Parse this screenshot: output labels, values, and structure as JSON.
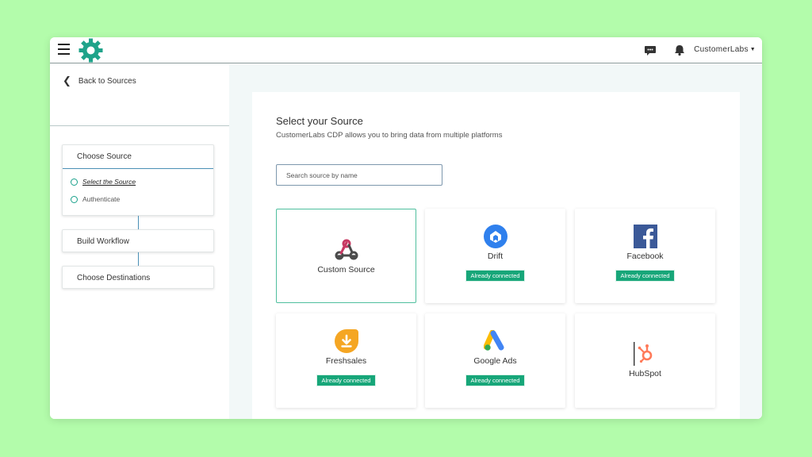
{
  "topbar": {
    "user_label": "CustomerLabs"
  },
  "sidebar": {
    "back_label": "Back to Sources",
    "steps": [
      {
        "title": "Choose Source",
        "substeps": [
          "Select the Source",
          "Authenticate"
        ]
      },
      {
        "title": "Build Workflow"
      },
      {
        "title": "Choose Destinations"
      }
    ]
  },
  "main": {
    "title": "Select your Source",
    "subtitle": "CustomerLabs CDP allows you to bring data from multiple platforms",
    "search_placeholder": "Search source by name",
    "sources": [
      {
        "name": "Custom Source",
        "icon": "webhook-icon",
        "status": ""
      },
      {
        "name": "Drift",
        "icon": "drift-icon",
        "status": "Already connected"
      },
      {
        "name": "Facebook",
        "icon": "facebook-icon",
        "status": "Already connected"
      },
      {
        "name": "Freshsales",
        "icon": "freshsales-icon",
        "status": "Already connected"
      },
      {
        "name": "Google Ads",
        "icon": "google-ads-icon",
        "status": "Already connected"
      },
      {
        "name": "HubSpot",
        "icon": "hubspot-icon",
        "status": ""
      }
    ]
  },
  "colors": {
    "background": "#b3fcab",
    "accent": "#17a679",
    "logo": "#1fa38a",
    "facebook": "#3b5998",
    "drift": "#2f80ed",
    "freshsales": "#f5a623",
    "hubspot": "#ff7a59"
  }
}
